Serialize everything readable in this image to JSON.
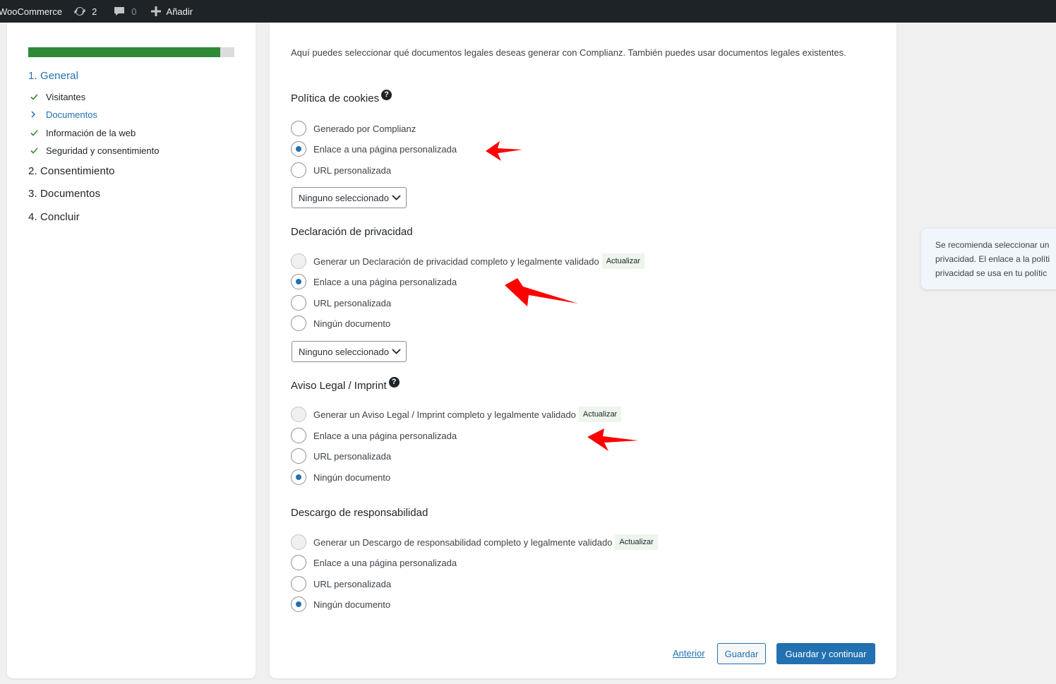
{
  "admin_bar": {
    "site_name": "WooCommerce",
    "updates_count": "2",
    "comments_count": "0",
    "new_label": "Añadir",
    "icons": [
      "updates-icon",
      "comments-icon",
      "plus-icon"
    ]
  },
  "sidebar": {
    "progress_percent": 93,
    "steps": [
      {
        "label": "1. General",
        "active": true,
        "substeps": [
          {
            "label": "Visitantes",
            "status": "done",
            "icon": "check-icon"
          },
          {
            "label": "Documentos",
            "status": "current",
            "icon": "chevron-right-icon"
          },
          {
            "label": "Información de la web",
            "status": "done",
            "icon": "check-icon"
          },
          {
            "label": "Seguridad y consentimiento",
            "status": "done",
            "icon": "check-icon"
          }
        ]
      },
      {
        "label": "2. Consentimiento"
      },
      {
        "label": "3. Documentos"
      },
      {
        "label": "4. Concluir"
      }
    ]
  },
  "main": {
    "intro_text": "Aquí puedes seleccionar qué documentos legales deseas generar con Complianz. También puedes usar documentos legales existentes.",
    "help_glyph": "?",
    "sections": [
      {
        "title": "Política de cookies",
        "has_help": true,
        "options": [
          {
            "label": "Generado por Complianz",
            "checked": false
          },
          {
            "label": "Enlace a una página personalizada",
            "checked": true
          },
          {
            "label": "URL personalizada",
            "checked": false
          }
        ],
        "select_value": "Ninguno seleccionado"
      },
      {
        "title": "Declaración de privacidad",
        "has_help": false,
        "options": [
          {
            "label": "Generar un Declaración de privacidad completo y legalmente validado",
            "checked": false,
            "disabled": true,
            "badge": "Actualizar"
          },
          {
            "label": "Enlace a una página personalizada",
            "checked": true
          },
          {
            "label": "URL personalizada",
            "checked": false
          },
          {
            "label": "Ningún documento",
            "checked": false
          }
        ],
        "select_value": "Ninguno seleccionado"
      },
      {
        "title": "Aviso Legal / Imprint",
        "has_help": true,
        "options": [
          {
            "label": "Generar un Aviso Legal / Imprint completo y legalmente validado",
            "checked": false,
            "disabled": true,
            "badge": "Actualizar"
          },
          {
            "label": "Enlace a una página personalizada",
            "checked": false
          },
          {
            "label": "URL personalizada",
            "checked": false
          },
          {
            "label": "Ningún documento",
            "checked": true
          }
        ]
      },
      {
        "title": "Descargo de responsabilidad",
        "has_help": false,
        "options": [
          {
            "label": "Generar un Descargo de responsabilidad completo y legalmente validado",
            "checked": false,
            "disabled": true,
            "badge": "Actualizar"
          },
          {
            "label": "Enlace a una página personalizada",
            "checked": false
          },
          {
            "label": "URL personalizada",
            "checked": false
          },
          {
            "label": "Ningún documento",
            "checked": true
          }
        ]
      }
    ],
    "footer": {
      "previous_label": "Anterior",
      "save_label": "Guardar",
      "save_continue_label": "Guardar y continuar"
    }
  },
  "tip": {
    "lines": [
      "Se recomienda seleccionar un",
      "privacidad. El enlace a la políti",
      "privacidad se usa en tu polític"
    ]
  },
  "colors": {
    "accent": "#2271b1",
    "progress": "#2e8a37",
    "annotation_arrow": "#ff0000",
    "admin_bar": "#1d2327"
  }
}
